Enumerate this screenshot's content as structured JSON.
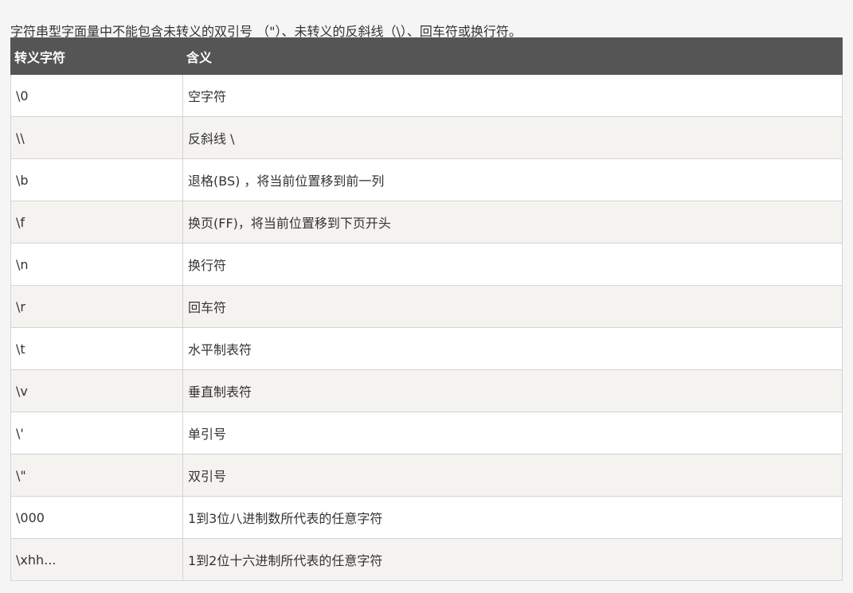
{
  "intro_text": "字符串型字面量中不能包含未转义的双引号 （\"）、未转义的反斜线（\\）、回车符或换行符。",
  "table": {
    "headers": [
      "转义字符",
      "含义"
    ],
    "rows": [
      [
        "\\0",
        "空字符"
      ],
      [
        "\\\\",
        "反斜线 \\"
      ],
      [
        "\\b",
        "退格(BS) ，将当前位置移到前一列"
      ],
      [
        "\\f",
        "换页(FF)，将当前位置移到下页开头"
      ],
      [
        "\\n",
        "换行符"
      ],
      [
        "\\r",
        "回车符"
      ],
      [
        "\\t",
        "水平制表符"
      ],
      [
        "\\v",
        "垂直制表符"
      ],
      [
        "\\'",
        "单引号"
      ],
      [
        "\\\"",
        "双引号"
      ],
      [
        "\\000",
        "1到3位八进制数所代表的任意字符"
      ],
      [
        "\\xhh...",
        "1到2位十六进制所代表的任意字符"
      ]
    ]
  },
  "colors": {
    "header_bg": "#555555",
    "header_text": "#ffffff",
    "row_odd": "#ffffff",
    "row_even": "#f4f3ef",
    "page_bg": "#f5f5f5",
    "border": "#d4d4d4",
    "text": "#333333"
  }
}
